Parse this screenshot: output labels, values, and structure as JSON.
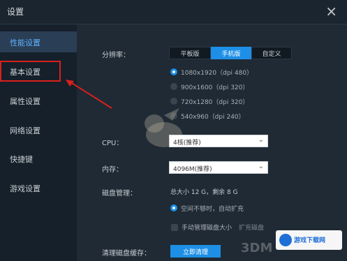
{
  "window": {
    "title": "设置",
    "close_label": "×"
  },
  "sidebar": {
    "items": [
      {
        "label": "性能设置"
      },
      {
        "label": "基本设置"
      },
      {
        "label": "属性设置"
      },
      {
        "label": "网络设置"
      },
      {
        "label": "快捷键"
      },
      {
        "label": "游戏设置"
      }
    ]
  },
  "resolution": {
    "label": "分辨率：",
    "tabs": [
      "平板版",
      "手机版",
      "自定义"
    ],
    "options": [
      {
        "text": "1080x1920（dpi 480）",
        "checked": true
      },
      {
        "text": "900x1600（dpi 320）",
        "checked": false
      },
      {
        "text": "720x1280（dpi 320）",
        "checked": false
      },
      {
        "text": "540x960（dpi 240）",
        "checked": false
      }
    ]
  },
  "cpu": {
    "label": "CPU：",
    "value": "4核(推荐)"
  },
  "memory": {
    "label": "内存：",
    "value": "4096M(推荐)"
  },
  "disk": {
    "label": "磁盘管理：",
    "summary": "总大小 12 G，剩余 8 G",
    "auto_option": "空间不够时，自动扩充",
    "manual_option": "手动管理磁盘大小",
    "expand_label": "扩充磁盘"
  },
  "cache": {
    "label": "清理磁盘缓存：",
    "button": "立即清理"
  },
  "watermark": {
    "text": "3DM",
    "brand": "游戏下载网"
  },
  "colors": {
    "accent": "#1e8fe6",
    "highlight_box": "#d9201c"
  }
}
